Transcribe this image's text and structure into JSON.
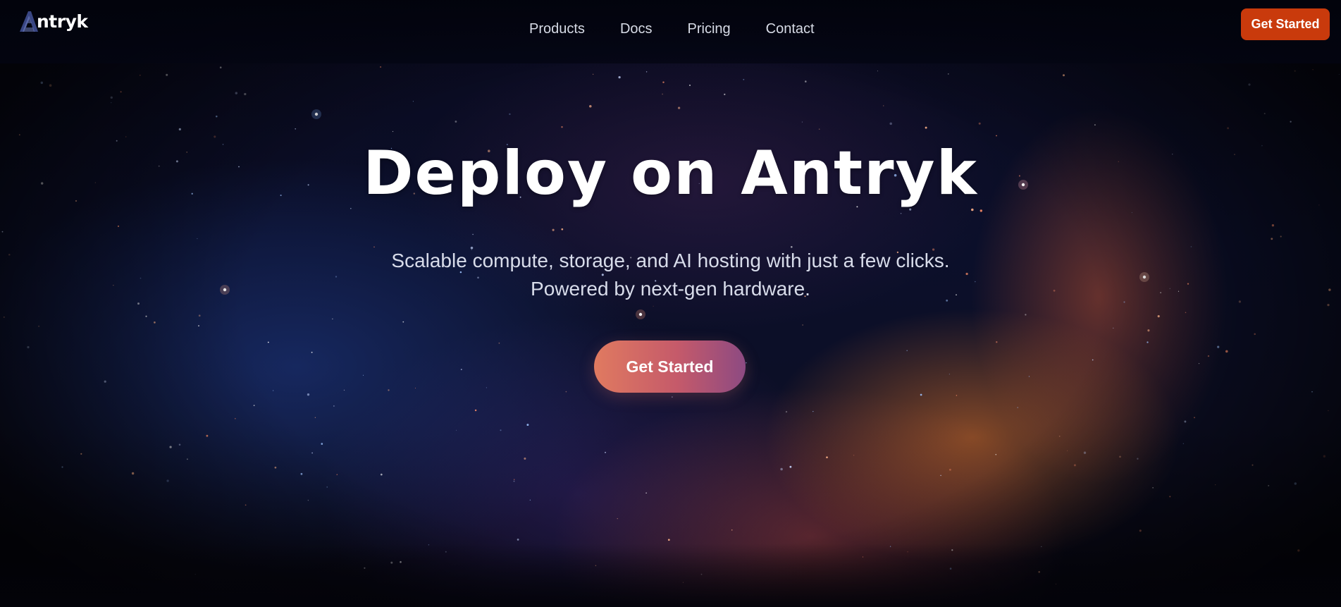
{
  "brand": {
    "name": "Antryk",
    "logo_letter": "A",
    "logo_rest": "ntryk",
    "accent_color": "#c93a0c"
  },
  "nav": {
    "links": [
      {
        "label": "Products"
      },
      {
        "label": "Docs"
      },
      {
        "label": "Pricing"
      },
      {
        "label": "Contact"
      }
    ],
    "cta_label": "Get Started"
  },
  "hero": {
    "headline": "Deploy on Antryk",
    "subtitle_line1": "Scalable compute, storage, and AI hosting with just a few clicks.",
    "subtitle_line2": "Powered by next-gen hardware.",
    "cta_label": "Get Started"
  }
}
